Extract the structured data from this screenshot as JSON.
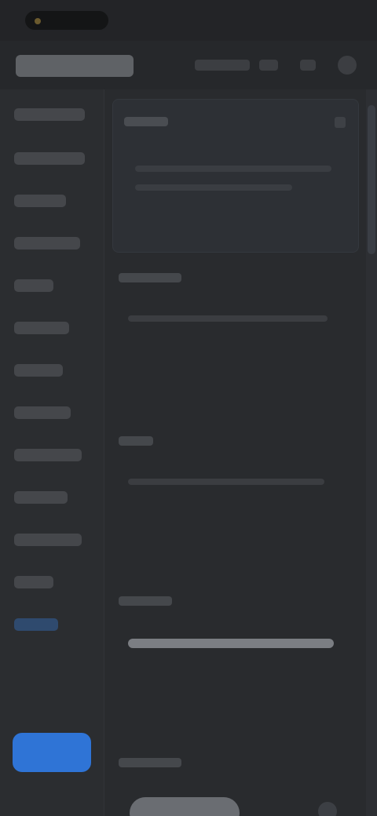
{
  "app": {
    "title": ""
  },
  "header": {
    "actions": [
      "",
      "",
      "",
      ""
    ]
  },
  "sidebar": {
    "items": [
      {
        "label": ""
      },
      {
        "label": ""
      },
      {
        "label": ""
      },
      {
        "label": ""
      },
      {
        "label": ""
      },
      {
        "label": ""
      },
      {
        "label": ""
      },
      {
        "label": ""
      },
      {
        "label": ""
      },
      {
        "label": ""
      },
      {
        "label": ""
      },
      {
        "label": ""
      },
      {
        "label": ""
      }
    ],
    "primary_button": ""
  },
  "main": {
    "featured": {
      "title": "",
      "close": "",
      "lines": [
        "",
        ""
      ]
    },
    "sections": [
      {
        "label": "",
        "line": ""
      },
      {
        "label": "",
        "line": ""
      },
      {
        "label": "",
        "line": ""
      },
      {
        "label": "",
        "line": ""
      }
    ]
  },
  "colors": {
    "background": "#2a2c2f",
    "accent": "#2f74d6",
    "active_item": "#2f4a6e"
  }
}
